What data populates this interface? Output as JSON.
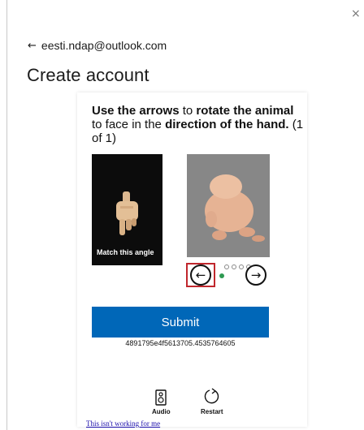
{
  "dialog": {
    "close_glyph": "×"
  },
  "header": {
    "back_glyph": "←",
    "email": "eesti.ndap@outlook.com",
    "title": "Create account"
  },
  "puzzle": {
    "instruction_parts": [
      "Use the arrows",
      " to ",
      "rotate the animal",
      " to face in the ",
      "direction of the hand.",
      " (1 of 1)"
    ],
    "hand_caption": "Match this angle",
    "left_arrow_glyph": "←",
    "right_arrow_glyph": "→",
    "position_dots": 5,
    "selected_dot": 1,
    "accent_red": "#c0272d",
    "accent_green": "#2e9a52"
  },
  "actions": {
    "submit_label": "Submit",
    "token": "4891795e4f5613705.4535764605",
    "audio_label": "Audio",
    "restart_label": "Restart",
    "help_link": "This isn't working for me",
    "brand_blue": "#0067b8"
  }
}
